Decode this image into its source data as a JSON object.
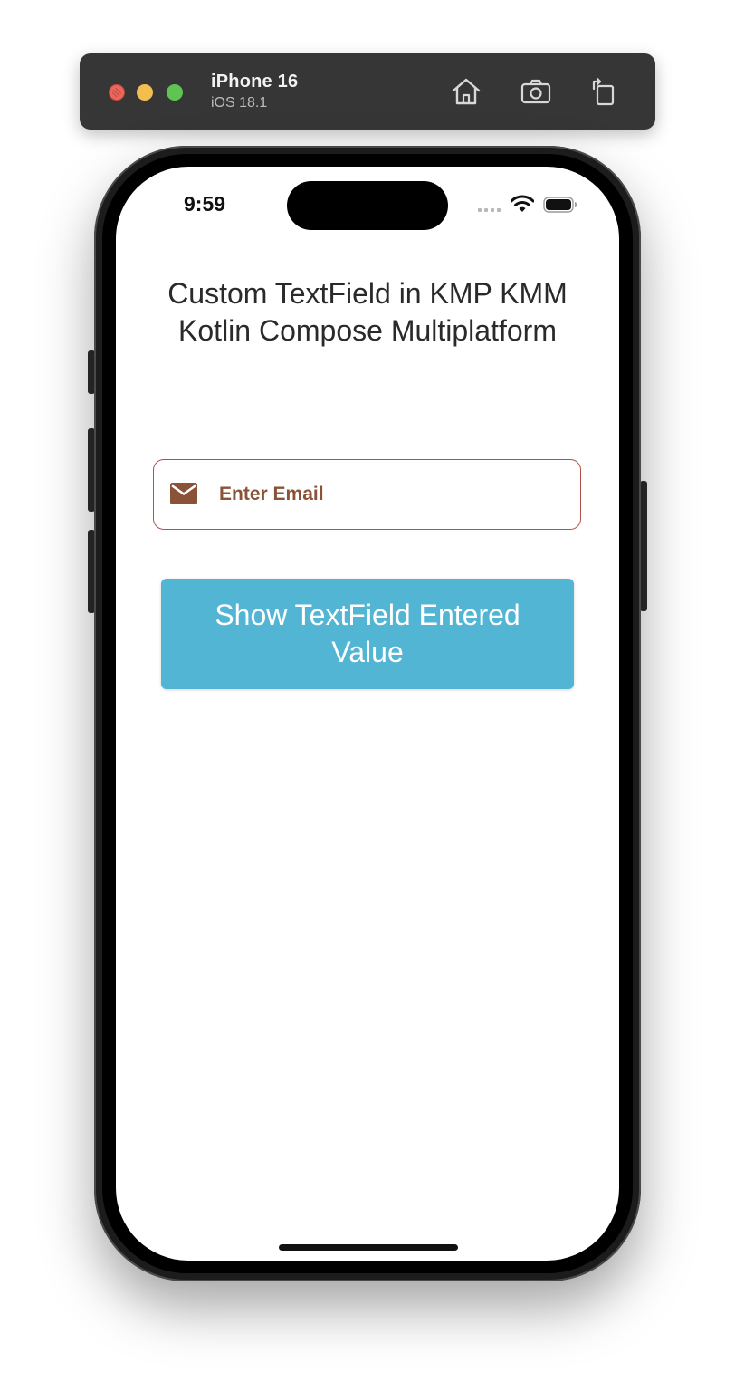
{
  "simulator": {
    "device_name": "iPhone 16",
    "os_version": "iOS 18.1",
    "icons": [
      "home-icon",
      "screenshot-icon",
      "rotate-icon"
    ]
  },
  "status_bar": {
    "time": "9:59"
  },
  "app": {
    "title": "Custom TextField in KMP KMM Kotlin Compose Multiplatform",
    "email_field": {
      "value": "",
      "placeholder": "Enter Email",
      "icon": "email-icon"
    },
    "show_button_label": "Show TextField Entered Value"
  },
  "colors": {
    "toolbar_bg": "#363636",
    "field_border": "#b2504a",
    "field_text": "#8a5236",
    "button_bg": "#53b5d4",
    "button_text": "#ffffff"
  }
}
